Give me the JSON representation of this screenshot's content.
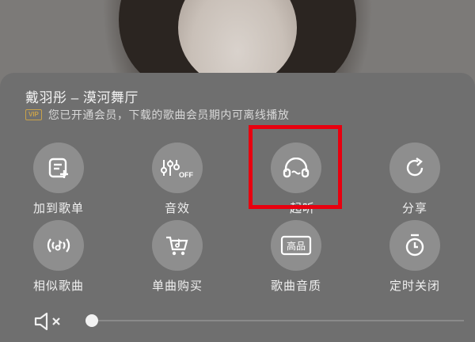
{
  "song": {
    "title": "戴羽彤 – 漠河舞厅"
  },
  "vip": {
    "badge": "VIP",
    "message": "您已开通会员，下载的歌曲会员期内可离线播放"
  },
  "actions": [
    {
      "label": "加到歌单",
      "icon": "add-to-playlist-icon"
    },
    {
      "label": "音效",
      "icon": "sound-effect-off-icon",
      "icon_text": "OFF"
    },
    {
      "label": "一起听",
      "icon": "listen-together-icon"
    },
    {
      "label": "分享",
      "icon": "share-icon"
    },
    {
      "label": "相似歌曲",
      "icon": "similar-songs-icon"
    },
    {
      "label": "单曲购买",
      "icon": "buy-song-icon"
    },
    {
      "label": "歌曲音质",
      "icon": "song-quality-icon",
      "icon_text": "高品"
    },
    {
      "label": "定时关闭",
      "icon": "timer-close-icon"
    }
  ],
  "volume": {
    "muted": true,
    "level": 0.0
  },
  "colors": {
    "highlight": "#e8000f",
    "vip_gold": "#c9a24a"
  }
}
